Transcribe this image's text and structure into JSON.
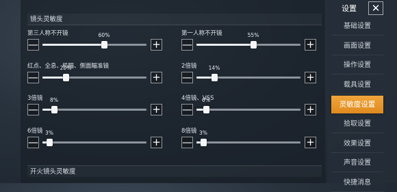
{
  "section_title": "镜头灵敏度",
  "bottom_section_title": "开火镜头灵敏度",
  "sliders": [
    {
      "label": "第三人称不开镜",
      "value": "60%",
      "fraction": 0.6
    },
    {
      "label": "第一人称不开镜",
      "value": "55%",
      "fraction": 0.55
    },
    {
      "label": "红点、全息、机瞄、侧面瞄准镜",
      "value": "20%",
      "fraction": 0.2
    },
    {
      "label": "2倍镜",
      "value": "14%",
      "fraction": 0.14
    },
    {
      "label": "3倍镜",
      "value": "8%",
      "fraction": 0.08
    },
    {
      "label": "4倍镜、VSS",
      "value": "6%",
      "fraction": 0.06
    },
    {
      "label": "6倍镜",
      "value": "3%",
      "fraction": 0.03
    },
    {
      "label": "8倍镜",
      "value": "3%",
      "fraction": 0.03
    }
  ],
  "buttons": {
    "minus": "—",
    "plus": "+"
  },
  "side_menu": {
    "title": "设置",
    "close": "✕",
    "items": [
      "基础设置",
      "画面设置",
      "操作设置",
      "载具设置",
      "灵敏度设置",
      "拾取设置",
      "效果设置",
      "声音设置",
      "快捷消息"
    ],
    "active_index": 4
  }
}
